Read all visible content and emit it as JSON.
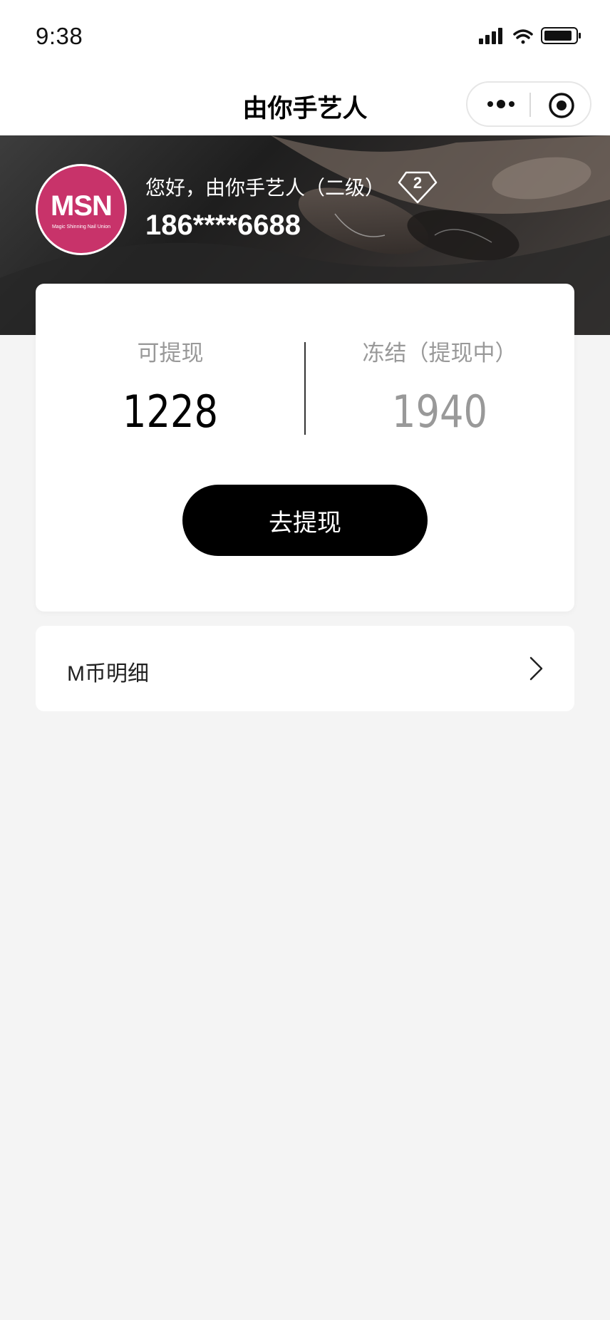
{
  "status_bar": {
    "time": "9:38"
  },
  "nav": {
    "title": "由你手艺人"
  },
  "profile": {
    "avatar_text": "MSN",
    "avatar_subtext": "Magic Shinning Nail Union",
    "greeting": "您好，由你手艺人（二级）",
    "level": "2",
    "phone": "186****6688"
  },
  "wallet": {
    "available_label": "可提现",
    "available_value": "1228",
    "frozen_label": "冻结（提现中）",
    "frozen_value": "1940",
    "withdraw_label": "去提现"
  },
  "detail": {
    "label": "M币明细"
  },
  "colors": {
    "avatar_bg": "#c8336a",
    "page_bg": "#f4f4f4",
    "button_bg": "#000000",
    "muted_text": "#999999"
  }
}
